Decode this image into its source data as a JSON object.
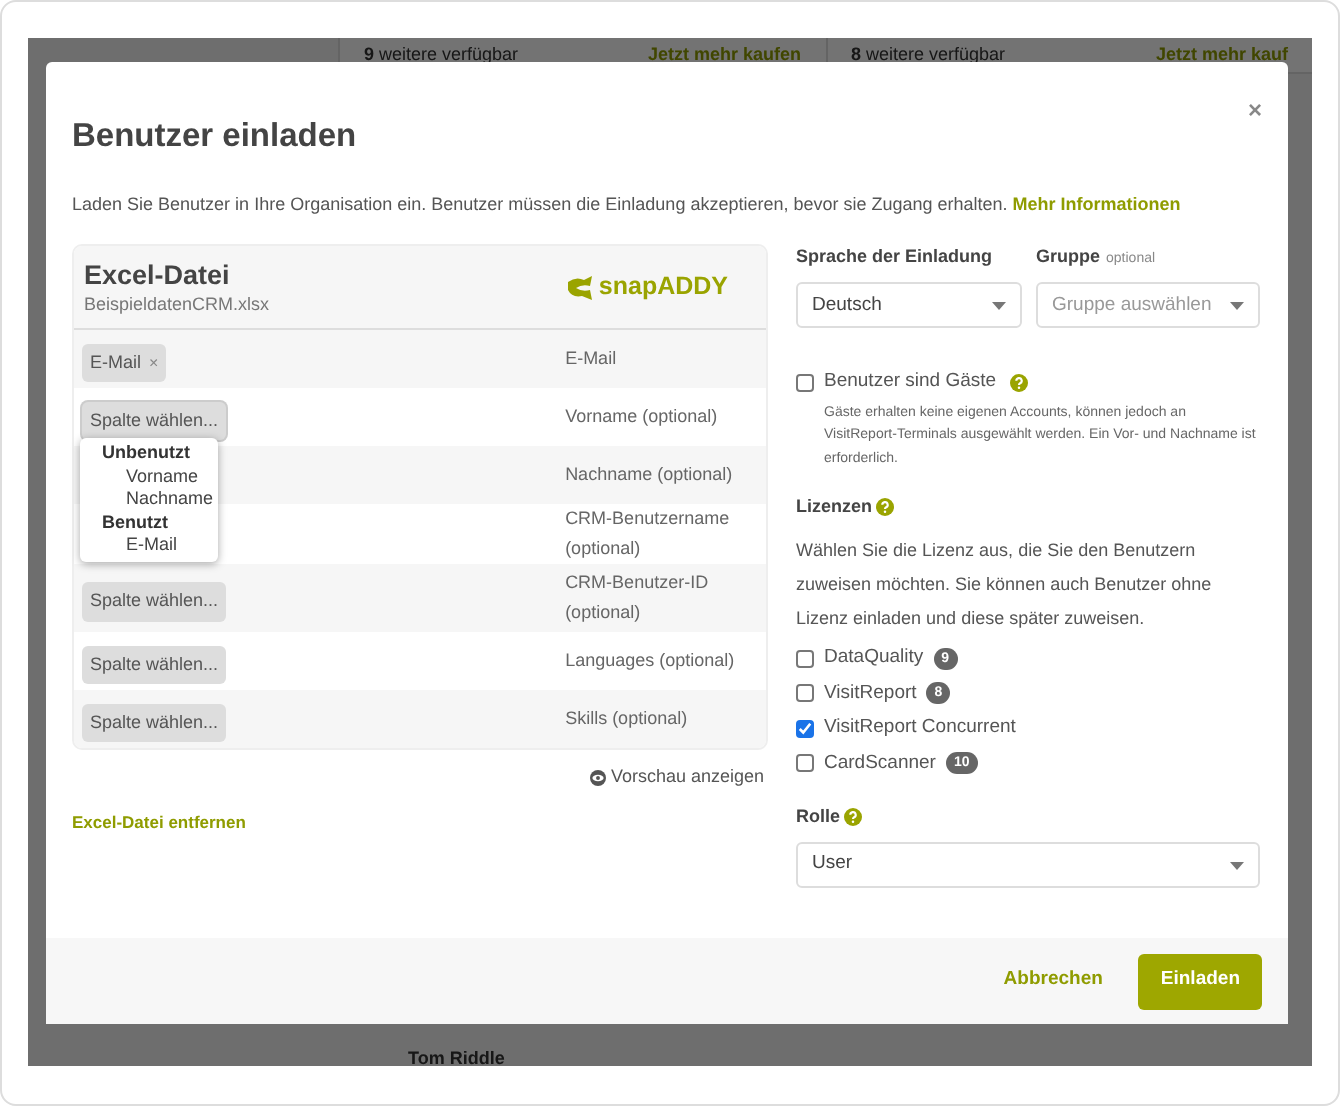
{
  "background": {
    "cells": [
      {
        "text": "**9** weitere verfügbar",
        "link": "Jetzt mehr kaufen"
      },
      {
        "text": "**8** weitere verfügbar",
        "link": "Jetzt mehr kauf"
      }
    ],
    "user_name": "Tom Riddle"
  },
  "dialog": {
    "title": "Benutzer einladen",
    "close": "×",
    "intro": "Laden Sie Benutzer in Ihre Organisation ein. Benutzer müssen die Einladung akzeptieren, bevor sie Zugang erhalten.",
    "intro_link": "Mehr Informationen",
    "file": {
      "title": "Excel-Datei",
      "filename": "BeispieldatenCRM.xlsx",
      "logo": "snapADDY",
      "rows": [
        {
          "kind": "tag",
          "value": "E-Mail",
          "remove": "×",
          "field": "E-Mail"
        },
        {
          "kind": "select",
          "value": "Spalte wählen...",
          "field": "Vorname (optional)",
          "expanded": true
        },
        {
          "kind": "covered",
          "field": "Nachname (optional)"
        },
        {
          "kind": "covered",
          "field": "CRM-Benutzername (optional)"
        },
        {
          "kind": "select",
          "value": "Spalte wählen...",
          "field": "CRM-Benutzer-ID (optional)",
          "expanded": false
        },
        {
          "kind": "select",
          "value": "Spalte wählen...",
          "field": "Languages (optional)",
          "expanded": false
        },
        {
          "kind": "select",
          "value": "Spalte wählen...",
          "field": "Skills (optional)",
          "expanded": false
        }
      ],
      "dropdown": [
        {
          "label": "Unbenutzt",
          "options": [
            "Vorname",
            "Nachname"
          ]
        },
        {
          "label": "Benutzt",
          "options": [
            "E-Mail"
          ]
        }
      ],
      "preview": "Vorschau anzeigen",
      "remove_link": "Excel-Datei entfernen"
    },
    "language": {
      "label": "Sprache der Einladung",
      "value": "Deutsch"
    },
    "group": {
      "label": "Gruppe",
      "hint": "optional",
      "placeholder": "Gruppe auswählen"
    },
    "guests": {
      "label": "Benutzer sind Gäste",
      "checked": false,
      "help": "Gäste erhalten keine eigenen Accounts, können jedoch an VisitReport-Terminals ausgewählt werden. Ein Vor- und Nachname ist erforderlich."
    },
    "licenses": {
      "label": "Lizenzen",
      "text": "Wählen Sie die Lizenz aus, die Sie den Benutzern zuweisen möchten. Sie können auch Benutzer ohne Lizenz einladen und diese später zuweisen.",
      "items": [
        {
          "name": "DataQuality",
          "count": "9",
          "checked": false
        },
        {
          "name": "VisitReport",
          "count": "8",
          "checked": false
        },
        {
          "name": "VisitReport Concurrent",
          "checked": true
        },
        {
          "name": "CardScanner",
          "count": "10",
          "checked": false
        }
      ]
    },
    "role": {
      "label": "Rolle",
      "value": "User"
    },
    "buttons": {
      "cancel": "Abbrechen",
      "submit": "Einladen"
    }
  }
}
